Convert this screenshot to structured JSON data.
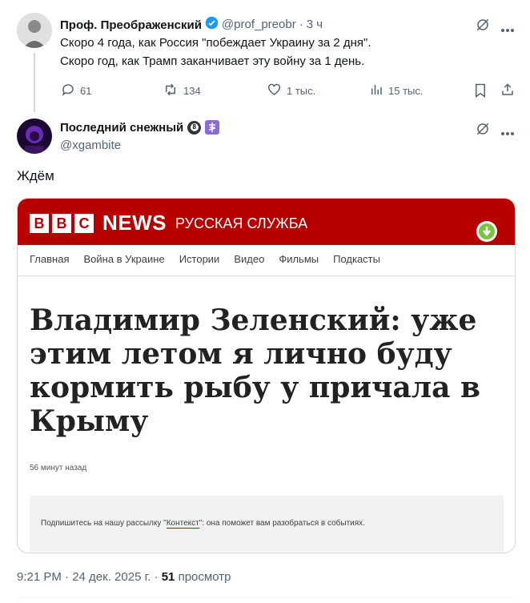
{
  "tweet1": {
    "author": "Проф. Преображенский",
    "handle": "@prof_preobr",
    "time": "3 ч",
    "text1": "Скоро 4 года, как Россия \"побеждает Украину за 2 дня\".",
    "text2": "Скоро год, как Трамп заканчивает эту войну за 1 день.",
    "replies": "61",
    "reposts": "134",
    "likes": "1 тыс.",
    "views": "15 тыс."
  },
  "tweet2": {
    "author": "Последний снежный",
    "handle": "@xgambite",
    "badge": "8",
    "text": "Ждём",
    "timestamp": "9:21 PM · 24 дек. 2025 г. · ",
    "view_count": "51",
    "view_label": " просмотр"
  },
  "embed": {
    "brand_letters": [
      "B",
      "B",
      "C"
    ],
    "news": "NEWS",
    "service": "РУССКАЯ СЛУЖБА",
    "nav": [
      "Главная",
      "Война в Украине",
      "Истории",
      "Видео",
      "Фильмы",
      "Подкасты"
    ],
    "headline": [
      "Владимир Зеленский: уже",
      "этим летом я лично буду",
      "кормить рыбу у причала в",
      "Крыму"
    ],
    "time_ago": "56 минут назад",
    "newsletter_a": "Подпишитесь на нашу рассылку \"",
    "newsletter_link": "Контекст",
    "newsletter_b": "\": она поможет вам разобраться в событиях."
  },
  "colors": {
    "bbc_red": "#b80000",
    "verified": "#1d9bf0",
    "download_green": "#7cc243"
  },
  "icons": [
    "verified-badge-icon",
    "grok-icon",
    "more-icon",
    "reply-icon",
    "repost-icon",
    "like-icon",
    "views-icon",
    "bookmark-icon",
    "share-icon",
    "download-icon",
    "cross-icon"
  ]
}
